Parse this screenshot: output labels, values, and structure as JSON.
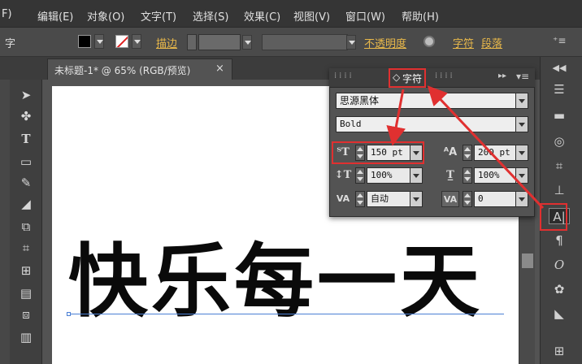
{
  "menu": {
    "file_partial": "F)",
    "items": [
      "编辑(E)",
      "对象(O)",
      "文字(T)",
      "选择(S)",
      "效果(C)",
      "视图(V)",
      "窗口(W)",
      "帮助(H)"
    ]
  },
  "control_bar": {
    "left_glyph": "字",
    "stroke_label": "描边",
    "opacity_label": "不透明度",
    "char_link": "字符",
    "para_link": "段落"
  },
  "document_tab": {
    "title": "未标题-1* @ 65% (RGB/预览)",
    "close": "×"
  },
  "canvas": {
    "text": "快乐每一天"
  },
  "char_panel": {
    "tab_label": "字符",
    "tab_prefix": "◇",
    "font_family": "思源黑体",
    "font_style": "Bold",
    "font_size": "150 pt",
    "leading": "200 pt",
    "vertical_scale": "100%",
    "horizontal_scale": "100%",
    "kerning": "自动",
    "tracking": "0"
  },
  "colors": {
    "highlight": "#e03030",
    "accent_link": "#e8b84a"
  }
}
